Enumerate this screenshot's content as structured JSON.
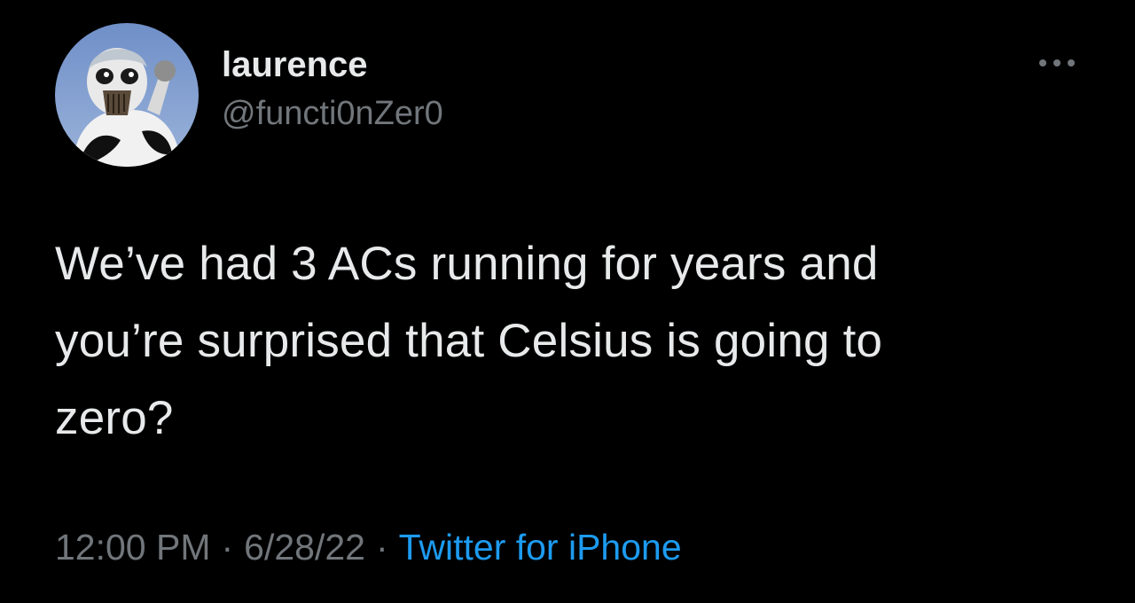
{
  "tweet": {
    "display_name": "laurence",
    "handle": "@functi0nZer0",
    "text_lines": [
      "We’ve had 3 ACs running for years and",
      "you’re surprised that Celsius is going to",
      "zero?"
    ],
    "time": "12:00 PM",
    "date": "6/28/22",
    "separator": "·",
    "source": "Twitter for iPhone"
  },
  "icons": {
    "more": "more-horizontal-icon"
  },
  "colors": {
    "background": "#000000",
    "primary_text": "#e7e9ea",
    "secondary_text": "#71767b",
    "link": "#1d9bf0"
  }
}
